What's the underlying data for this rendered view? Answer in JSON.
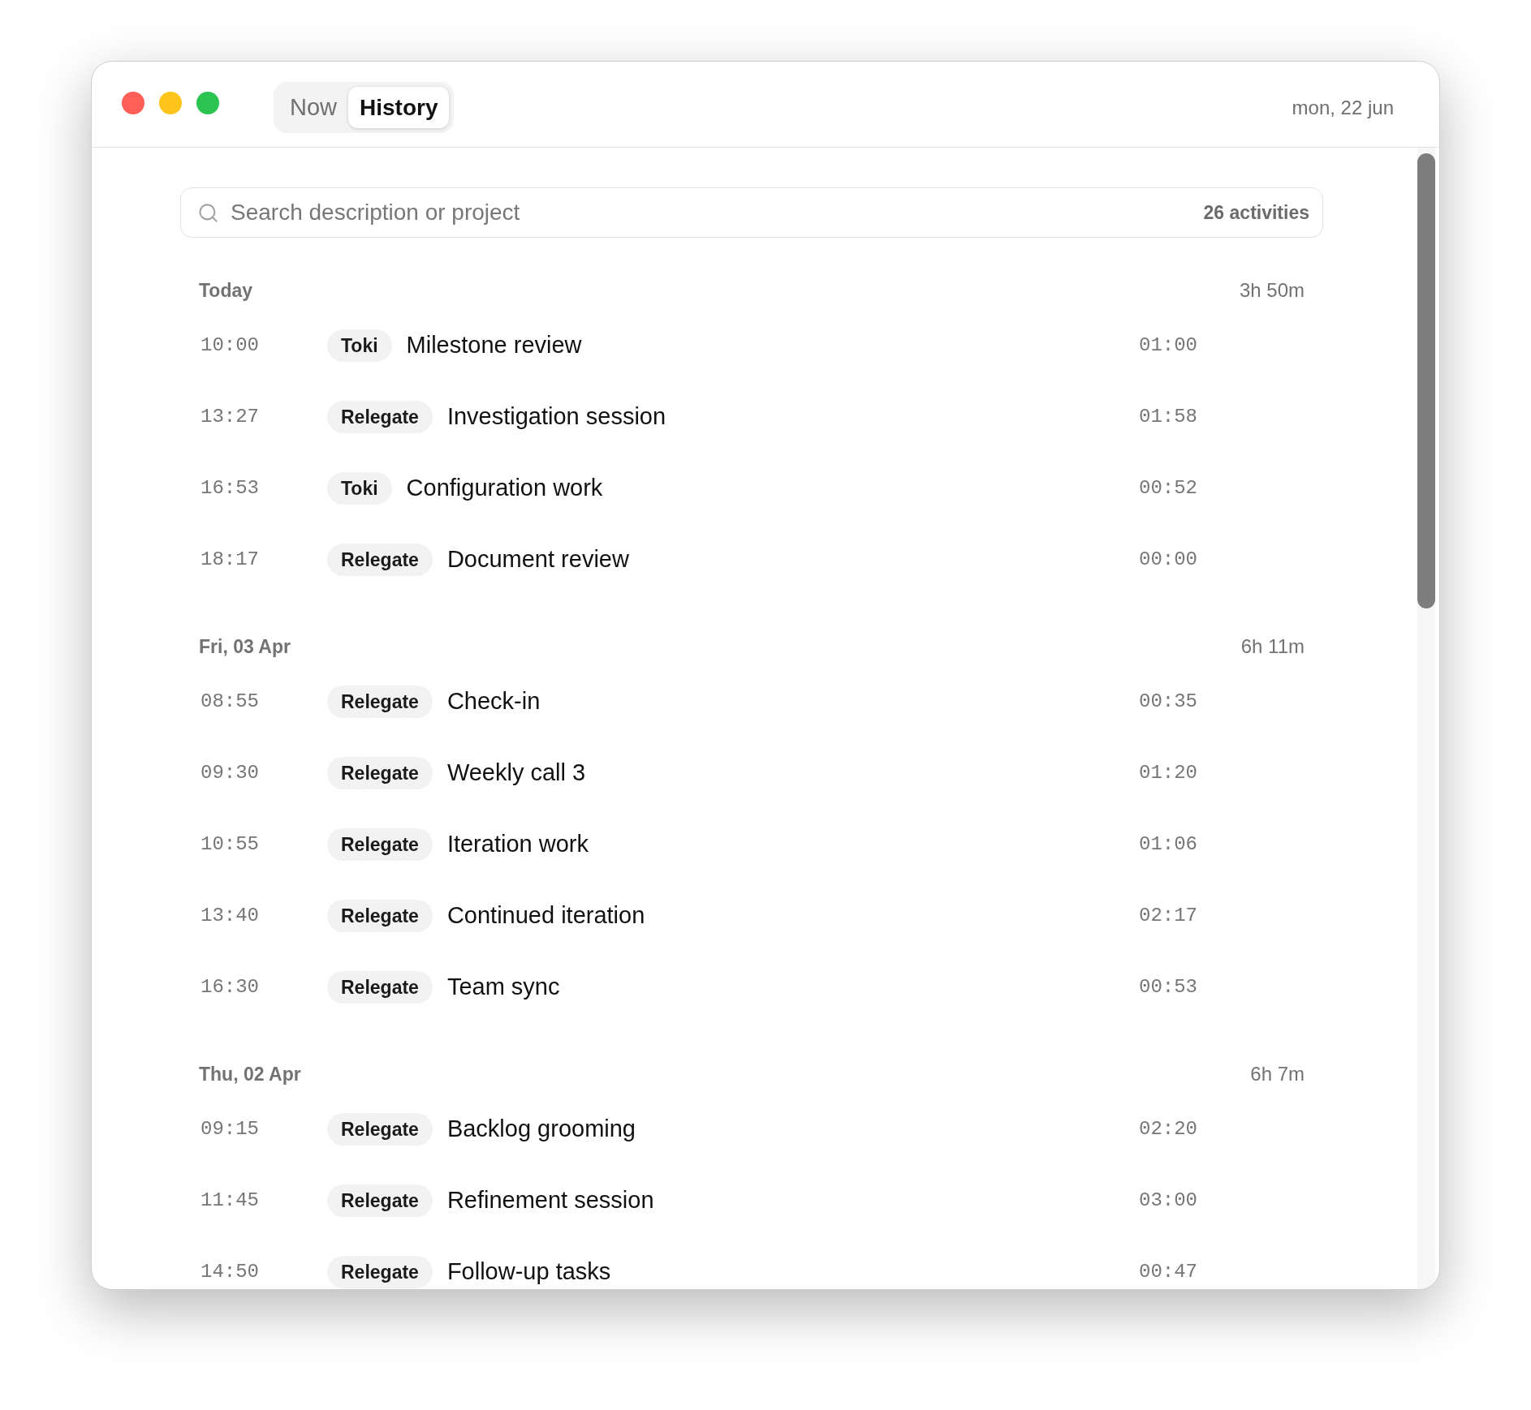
{
  "tabs": [
    {
      "label": "Now",
      "selected": false
    },
    {
      "label": "History",
      "selected": true
    }
  ],
  "date": "mon, 22 jun",
  "search": {
    "placeholder": "Search description or project",
    "count": "26 activities"
  },
  "groups": [
    {
      "label": "Today",
      "total": "3h 50m",
      "activities": [
        {
          "start": "10:00",
          "project": "Toki",
          "description": "Milestone review",
          "duration": "01:00"
        },
        {
          "start": "13:27",
          "project": "Relegate",
          "description": "Investigation session",
          "duration": "01:58"
        },
        {
          "start": "16:53",
          "project": "Toki",
          "description": "Configuration work",
          "duration": "00:52"
        },
        {
          "start": "18:17",
          "project": "Relegate",
          "description": "Document review",
          "duration": "00:00"
        }
      ]
    },
    {
      "label": "Fri, 03 Apr",
      "total": "6h 11m",
      "activities": [
        {
          "start": "08:55",
          "project": "Relegate",
          "description": "Check-in",
          "duration": "00:35"
        },
        {
          "start": "09:30",
          "project": "Relegate",
          "description": "Weekly call 3",
          "duration": "01:20"
        },
        {
          "start": "10:55",
          "project": "Relegate",
          "description": "Iteration work",
          "duration": "01:06"
        },
        {
          "start": "13:40",
          "project": "Relegate",
          "description": "Continued iteration",
          "duration": "02:17"
        },
        {
          "start": "16:30",
          "project": "Relegate",
          "description": "Team sync",
          "duration": "00:53"
        }
      ]
    },
    {
      "label": "Thu, 02 Apr",
      "total": "6h 7m",
      "activities": [
        {
          "start": "09:15",
          "project": "Relegate",
          "description": "Backlog grooming",
          "duration": "02:20"
        },
        {
          "start": "11:45",
          "project": "Relegate",
          "description": "Refinement session",
          "duration": "03:00"
        },
        {
          "start": "14:50",
          "project": "Relegate",
          "description": "Follow-up tasks",
          "duration": "00:47"
        }
      ]
    }
  ]
}
